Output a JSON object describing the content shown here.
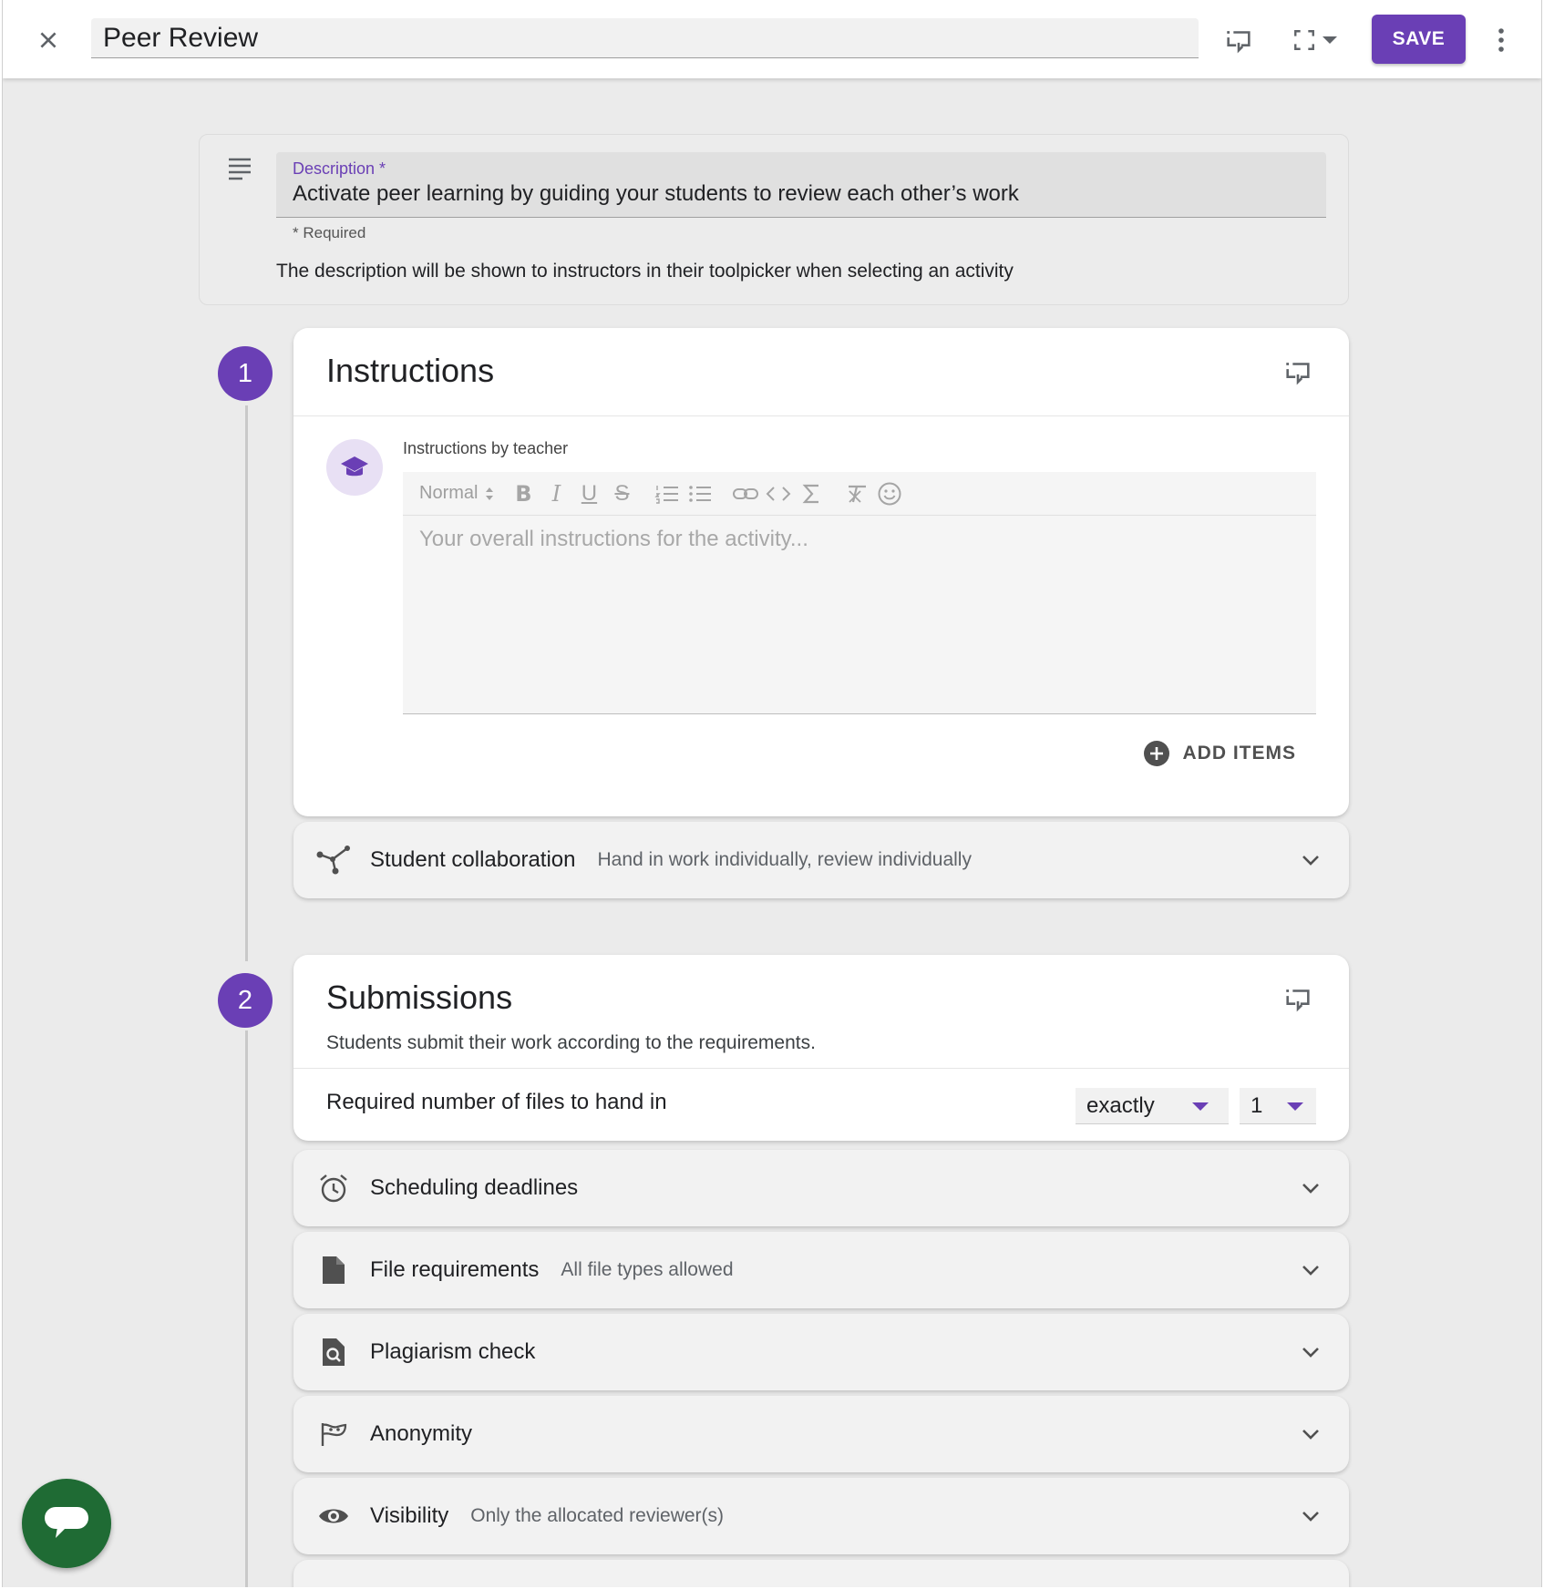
{
  "header": {
    "title": "Peer Review",
    "save_label": "SAVE"
  },
  "description": {
    "label": "Description *",
    "value": "Activate peer learning by guiding your students to review each other’s work",
    "required_note": "* Required",
    "help_text": "The description will be shown to instructors in their toolpicker when selecting an activity"
  },
  "steps": [
    {
      "number": "1",
      "title": "Instructions",
      "editor_label": "Instructions by teacher",
      "format_select": "Normal",
      "editor_placeholder": "Your overall instructions for the activity...",
      "add_items_label": "ADD ITEMS"
    },
    {
      "number": "2",
      "title": "Submissions",
      "subtitle": "Students submit their work according to the requirements.",
      "files_label": "Required number of files to hand in",
      "files_mode": "exactly",
      "files_count": "1"
    }
  ],
  "accordions": {
    "collaboration": {
      "title": "Student collaboration",
      "summary": "Hand in work individually, review individually",
      "icon": "share-network-icon"
    },
    "scheduling": {
      "title": "Scheduling deadlines",
      "summary": "",
      "icon": "alarm-clock-icon"
    },
    "file_requirements": {
      "title": "File requirements",
      "summary": "All file types allowed",
      "icon": "file-icon"
    },
    "plagiarism": {
      "title": "Plagiarism check",
      "summary": "",
      "icon": "file-search-icon"
    },
    "anonymity": {
      "title": "Anonymity",
      "summary": "",
      "icon": "mask-icon"
    },
    "visibility": {
      "title": "Visibility",
      "summary": "Only the allocated reviewer(s)",
      "icon": "eye-icon"
    }
  },
  "colors": {
    "accent": "#6a3fb5",
    "fab": "#1f6b34",
    "background": "#ebebeb"
  }
}
